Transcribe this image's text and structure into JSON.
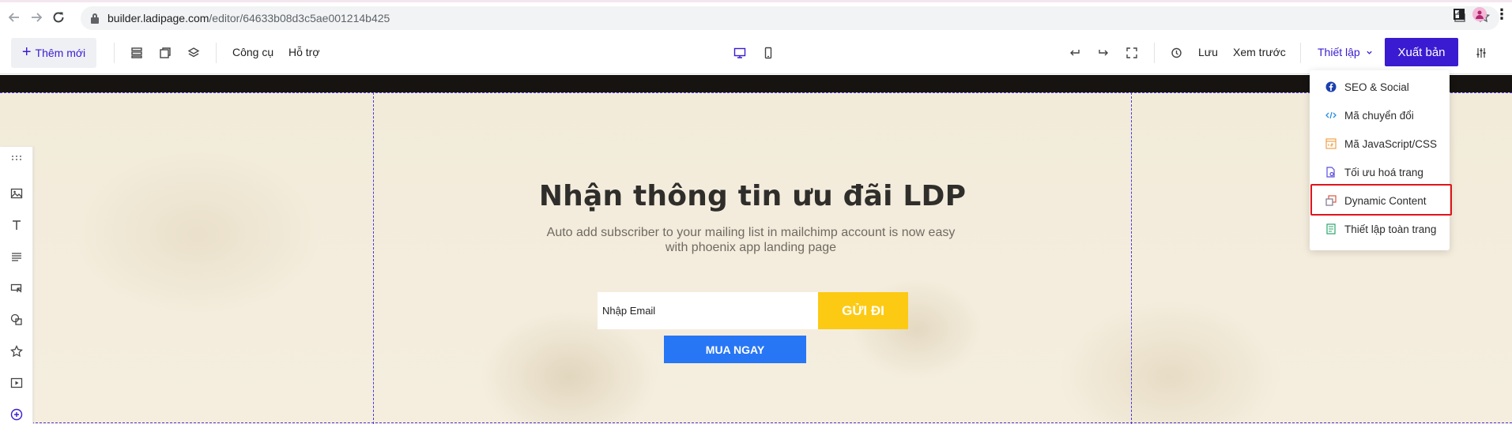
{
  "browser": {
    "url_host": "builder.ladipage.com",
    "url_path": "/editor/64633b08d3c5ae001214b425",
    "icons": [
      "back-arrow-icon",
      "forward-arrow-icon",
      "reload-icon",
      "lock-icon",
      "share-icon",
      "star-icon",
      "side-panel-icon",
      "profile-avatar-icon",
      "kebab-menu-icon"
    ]
  },
  "toolbar": {
    "add_new_label": "Thêm mới",
    "tools_label": "Công cụ",
    "support_label": "Hỗ trợ",
    "save_label": "Lưu",
    "preview_label": "Xem trước",
    "settings_label": "Thiết lập",
    "publish_label": "Xuất bản",
    "accent_color": "#3b1bd1"
  },
  "settings_menu": {
    "items": [
      {
        "label": "SEO & Social",
        "icon": "facebook-icon",
        "icon_color": "#1b3fae"
      },
      {
        "label": "Mã chuyển đổi",
        "icon": "code-icon",
        "icon_color": "#2a8fe0"
      },
      {
        "label": "Mã JavaScript/CSS",
        "icon": "js-css-icon",
        "icon_color": "#f0a24b"
      },
      {
        "label": "Tối ưu hoá trang",
        "icon": "page-optimize-icon",
        "icon_color": "#5b4de0"
      },
      {
        "label": "Dynamic Content",
        "icon": "dynamic-content-icon",
        "icon_color": "#e0533c"
      },
      {
        "label": "Thiết lập toàn trang",
        "icon": "page-settings-icon",
        "icon_color": "#2aa66b"
      }
    ],
    "highlighted_item": "Dynamic Content",
    "highlight_color": "#e0141c"
  },
  "canvas": {
    "headline": "Nhận thông tin ưu đãi LDP",
    "subtext": "Auto add subscriber to your mailing list in mailchimp account is now easy with phoenix app landing page",
    "email_placeholder": "Nhập Email",
    "send_button": "GỬI ĐI",
    "buy_button": "MUA NGAY",
    "send_button_color": "#fcca13",
    "buy_button_color": "#2776f5"
  },
  "left_tools": [
    "drag-handle-icon",
    "image-icon",
    "text-icon",
    "paragraph-icon",
    "button-icon",
    "shape-icon",
    "star-icon",
    "video-icon",
    "add-circle-icon"
  ]
}
